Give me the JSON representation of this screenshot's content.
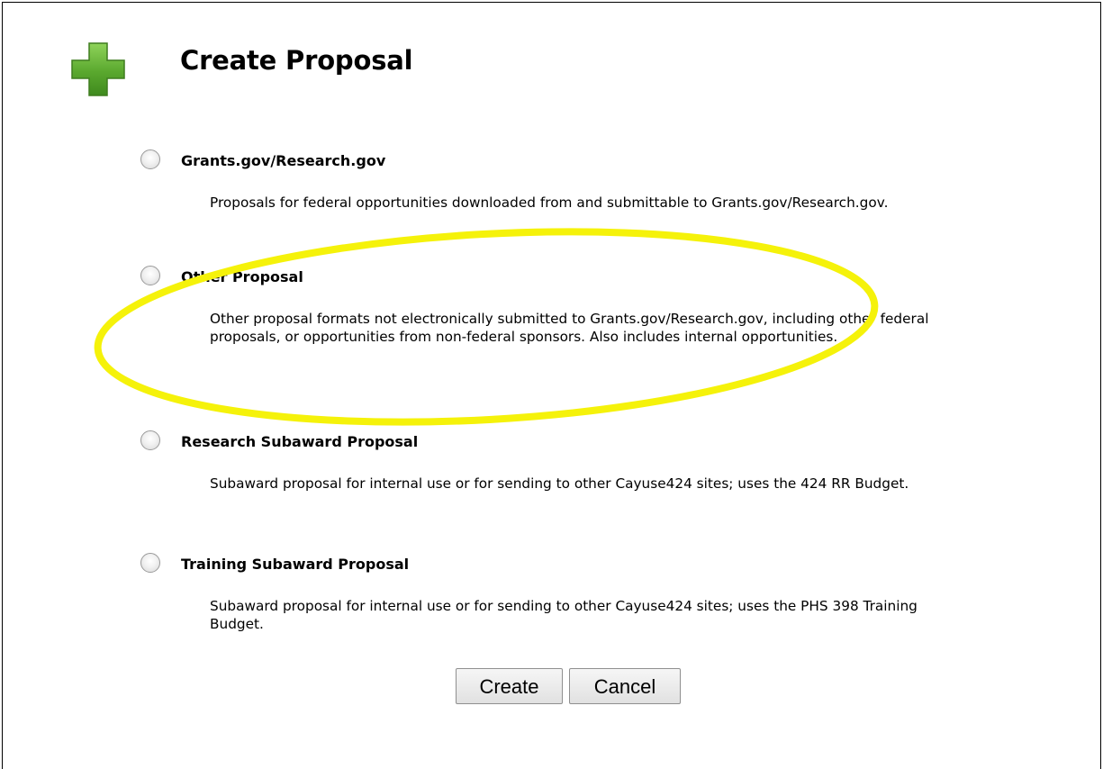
{
  "page": {
    "title": "Create Proposal",
    "icon": "plus-icon",
    "icon_color": "#5aa82e",
    "highlight_color": "#f5f20a"
  },
  "options": [
    {
      "label": "Grants.gov/Research.gov",
      "description": "Proposals for federal opportunities downloaded from and submittable to Grants.gov/Research.gov.",
      "selected": false
    },
    {
      "label": "Other Proposal",
      "description": "Other proposal formats not electronically submitted to Grants.gov/Research.gov, including other federal proposals, or opportunities from non-federal sponsors. Also includes internal opportunities.",
      "selected": false
    },
    {
      "label": "Research Subaward Proposal",
      "description": "Subaward proposal for internal use or for sending to other Cayuse424 sites; uses the 424 RR Budget.",
      "selected": false
    },
    {
      "label": "Training Subaward Proposal",
      "description": "Subaward proposal for internal use or for sending to other Cayuse424 sites; uses the PHS 398 Training Budget.",
      "selected": false
    }
  ],
  "buttons": {
    "create_label": "Create",
    "cancel_label": "Cancel"
  }
}
